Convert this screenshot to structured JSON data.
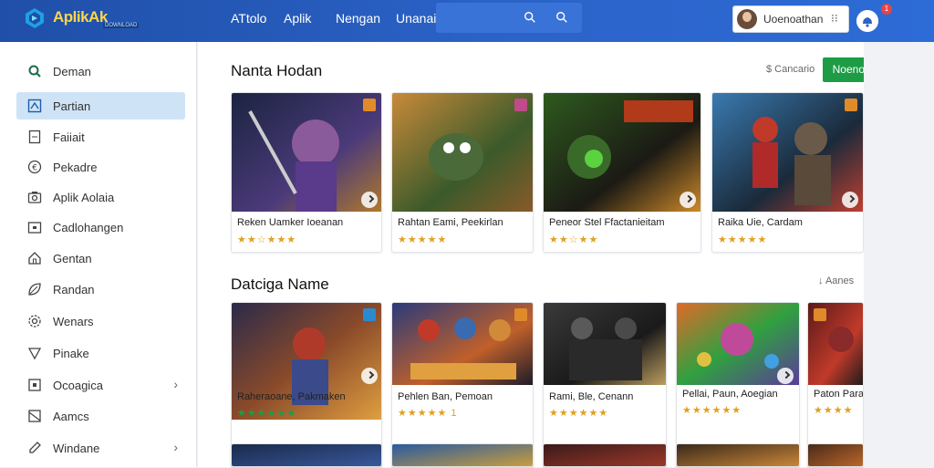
{
  "app": {
    "logo_text": "AplikAk",
    "logo_sub": "DOWNLOAD",
    "brand_color": "#1f4fa8"
  },
  "nav": [
    "ATtolo",
    "Aplik",
    "Nengan",
    "Unanai"
  ],
  "user": {
    "name": "Uoenoathan",
    "more": "⁝⁝",
    "notifications": "1"
  },
  "sidebar": {
    "items": [
      {
        "label": "Deman",
        "icon": "search-icon"
      },
      {
        "label": "Partian",
        "icon": "apps-icon",
        "active": true
      },
      {
        "label": "Faiiait",
        "icon": "document-icon"
      },
      {
        "label": "Pekadre",
        "icon": "coin-icon"
      },
      {
        "label": "Aplik Aolaia",
        "icon": "camera-icon"
      },
      {
        "label": "Cadlohangen",
        "icon": "folder-icon"
      },
      {
        "label": "Gentan",
        "icon": "home-icon"
      },
      {
        "label": "Randan",
        "icon": "leaf-icon"
      },
      {
        "label": "Wenars",
        "icon": "gear-icon"
      },
      {
        "label": "Pinake",
        "icon": "shield-icon"
      },
      {
        "label": "Ocoagica",
        "icon": "square-icon",
        "chevron": "›"
      },
      {
        "label": "Aamcs",
        "icon": "image-icon"
      },
      {
        "label": "Windane",
        "icon": "pen-icon",
        "chevron": "›"
      }
    ]
  },
  "section1": {
    "title": "Nanta Hodan",
    "right_text": "$ Cancario",
    "button": "Noenot",
    "cards": [
      {
        "title": "Reken Uamker Ioeanan",
        "rating": "★★☆★★★",
        "colors": [
          "#4b3a7a",
          "#1b2440",
          "#b07a2a"
        ]
      },
      {
        "title": "Rahtan Eami, Peekirlan",
        "rating": "★★★★★",
        "colors": [
          "#c98a3a",
          "#3b5a2a",
          "#8a5a2a"
        ]
      },
      {
        "title": "Peneor Stel Ffactanieitam",
        "rating": "★★☆★★",
        "colors": [
          "#2e5a1e",
          "#1b1a14",
          "#d08a2a"
        ]
      },
      {
        "title": "Raika Uie, Cardam",
        "rating": "★★★★★",
        "colors": [
          "#3a7ab0",
          "#1a2a3a",
          "#c04030"
        ]
      }
    ]
  },
  "section2": {
    "title": "Datciga Name",
    "right_text": "↓ Aanes",
    "cards": [
      {
        "title": "Raheraoane, Pakmaken",
        "rating": "★★★★★★",
        "colors": [
          "#8a4a2a",
          "#2a2a4a",
          "#e0a040"
        ]
      },
      {
        "title": "Pehlen Ban, Pemoan",
        "rating": "★★★★★ 1",
        "colors": [
          "#2a3a7a",
          "#c0602a",
          "#1a1a2a"
        ]
      },
      {
        "title": "Rami, Ble, Cenann",
        "rating": "★★★★★★",
        "colors": [
          "#3a3a3a",
          "#1a1a1a",
          "#c0a060"
        ]
      },
      {
        "title": "Pellai, Paun, Aoegian",
        "rating": "★★★★★★",
        "colors": [
          "#e06a2a",
          "#30a040",
          "#5a3a9a"
        ]
      },
      {
        "title": "Paton Para",
        "rating": "★★★★",
        "colors": [
          "#5a1a1a",
          "#c03a2a",
          "#1a1a1a"
        ]
      }
    ]
  },
  "section3": {
    "cards": [
      {
        "colors": [
          "#1a2a4a",
          "#3a5aa0"
        ]
      },
      {
        "colors": [
          "#2a5aa0",
          "#d0a03a"
        ]
      },
      {
        "colors": [
          "#3a1a1a",
          "#a03a2a"
        ]
      },
      {
        "colors": [
          "#3a2a1a",
          "#d08a3a"
        ]
      },
      {
        "colors": [
          "#4a2a1a",
          "#c06a2a"
        ]
      }
    ]
  }
}
